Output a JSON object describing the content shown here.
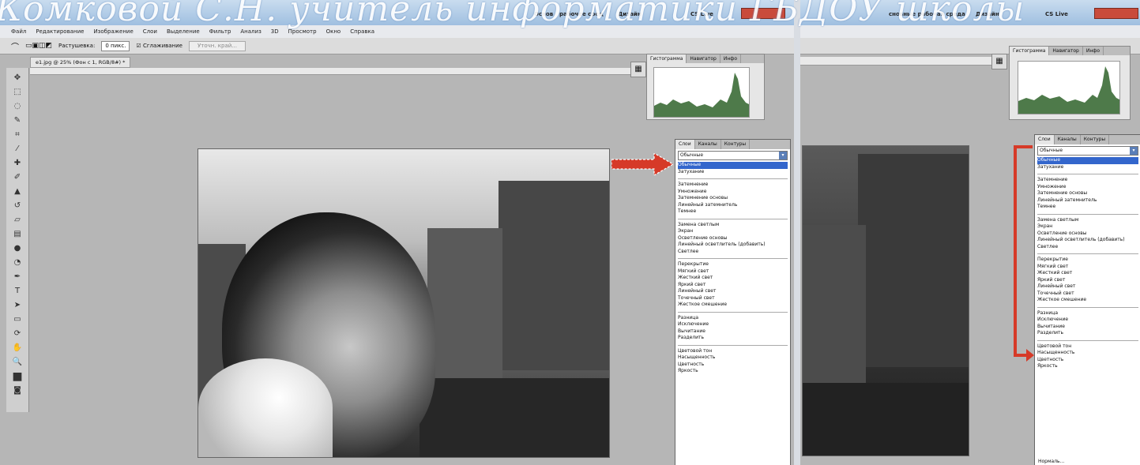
{
  "watermark": {
    "text": "Комковой С.Н. учитель информатики ГБДОУ школы"
  },
  "left": {
    "top_buttons": {
      "basics": "Основ",
      "workspace": "рабочее сред",
      "design": "Дизайн",
      "cslive": "CS Live"
    },
    "menu": [
      "Файл",
      "Редактирование",
      "Изображение",
      "Слои",
      "Выделение",
      "Фильтр",
      "Анализ",
      "3D",
      "Просмотр",
      "Окно",
      "Справка"
    ],
    "options": {
      "feather_label": "Растушевка:",
      "feather_value": "0 пикс.",
      "smooth_label": "Сглаживание",
      "refine_label": "Уточн. край..."
    },
    "doc_tab": "e1.jpg @ 25% (Фон с 1, RGB/8#) *",
    "histogram_tabs": [
      "Гистограмма",
      "Навигатор",
      "Инфо"
    ],
    "layers_tabs": [
      "Слои",
      "Каналы",
      "Контуры"
    ],
    "blend_mode": "Обычные",
    "blend_options": [
      [
        "Обычные",
        "Затухание"
      ],
      [
        "Затемнение",
        "Умножение",
        "Затемнение основы",
        "Линейный затемнитель",
        "Темнее"
      ],
      [
        "Замена светлым",
        "Экран",
        "Осветление основы",
        "Линейный осветлитель (добавить)",
        "Светлее"
      ],
      [
        "Перекрытие",
        "Мягкий свет",
        "Жесткий свет",
        "Яркий свет",
        "Линейный свет",
        "Точечный свет",
        "Жесткое смешение"
      ],
      [
        "Разница",
        "Исключение",
        "Вычитание",
        "Разделить"
      ],
      [
        "Цветовой тон",
        "Насыщенность",
        "Цветность",
        "Яркость"
      ]
    ]
  },
  "right": {
    "top_buttons": {
      "workspace": "сновные рабочая среда",
      "design": "Дизайн",
      "cslive": "CS Live"
    },
    "histogram_tabs": [
      "Гистограмма",
      "Навигатор",
      "Инфо"
    ],
    "layers_tabs": [
      "Слои",
      "Каналы",
      "Контуры"
    ],
    "blend_mode": "Обычные",
    "blend_options": [
      [
        "Обычные",
        "Затухание"
      ],
      [
        "Затемнение",
        "Умножение",
        "Затемнение основы",
        "Линейный затемнитель",
        "Темнее"
      ],
      [
        "Замена светлым",
        "Экран",
        "Осветление основы",
        "Линейный осветлитель (добавить)",
        "Светлее"
      ],
      [
        "Перекрытие",
        "Мягкий свет",
        "Жесткий свет",
        "Яркий свет",
        "Линейный свет",
        "Точечный свет",
        "Жесткое смешение"
      ],
      [
        "Разница",
        "Исключение",
        "Вычитание",
        "Разделить"
      ],
      [
        "Цветовой тон",
        "Насыщенность",
        "Цветность",
        "Яркость"
      ]
    ],
    "bottom_fragment": "Нормаль..."
  },
  "colors": {
    "histogram_fill": "#4e7a4a",
    "arrow_red": "#d63a28",
    "selection_blue": "#3366cc"
  }
}
